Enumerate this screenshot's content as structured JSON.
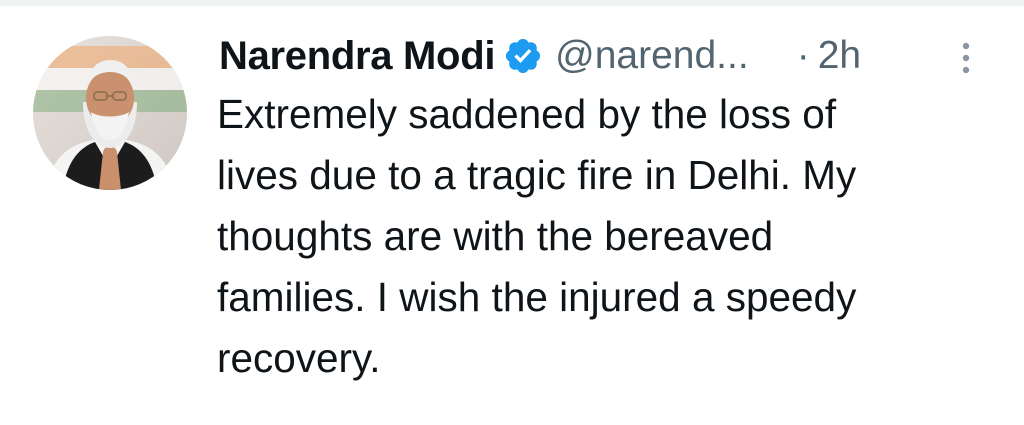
{
  "tweet": {
    "author_name": "Narendra Modi",
    "handle": "@narend...",
    "separator": "·",
    "time": "2h",
    "verified_icon": "verified-badge-icon",
    "more_icon": "more-vertical-icon",
    "text_lines": [
      "Extremely saddened by the loss of",
      "lives due to a tragic fire in Delhi. My",
      "thoughts are with the bereaved",
      "families. I wish the injured a speedy",
      "recovery."
    ]
  },
  "colors": {
    "text_primary": "#0f1419",
    "text_secondary": "#536471",
    "verified": "#1d9bf0"
  }
}
